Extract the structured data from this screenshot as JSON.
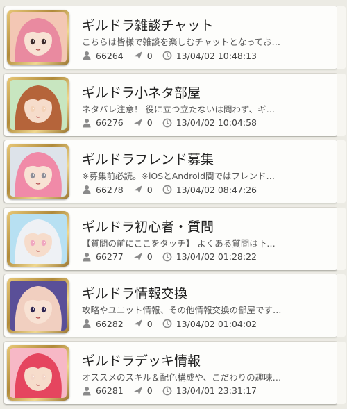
{
  "colors": {
    "background": "#ecebe4",
    "card": "#fdfdfb",
    "title_text": "#222222",
    "desc_text": "#555555",
    "meta_icon": "#8a8a8a",
    "thumb_frame": "#c9a34e"
  },
  "icons": {
    "member": "person-icon",
    "posts": "send-arrow-icon",
    "updated": "clock-icon"
  },
  "rooms": [
    {
      "title": "ギルドラ雑談チャット",
      "description": "こちらは皆様で雑談を楽しむチャットとなってお…",
      "members": "66264",
      "posts": "0",
      "timestamp": "13/04/02 10:48:13",
      "thumb_colors": [
        "#f3c7b4",
        "#e98aa0",
        "#3b2a2a"
      ]
    },
    {
      "title": "ギルドラ小ネタ部屋",
      "description": "ネタバレ注意！ 役に立つ立たないは問わず、ギ…",
      "members": "66276",
      "posts": "0",
      "timestamp": "13/04/02 10:04:58",
      "thumb_colors": [
        "#c8e6c0",
        "#b5643a",
        "#f3d2b8"
      ]
    },
    {
      "title": "ギルドラフレンド募集",
      "description": "※募集前必読。※iOSとAndroid間ではフレンド…",
      "members": "66278",
      "posts": "0",
      "timestamp": "13/04/02 08:47:26",
      "thumb_colors": [
        "#dde3ea",
        "#f08aa8",
        "#8d8f98"
      ]
    },
    {
      "title": "ギルドラ初心者・質問",
      "description": "【質問の前にここをタッチ】 よくある質問は下…",
      "members": "66277",
      "posts": "0",
      "timestamp": "13/04/02 01:28:22",
      "thumb_colors": [
        "#b7e0f2",
        "#eef1f5",
        "#f0a7c0"
      ]
    },
    {
      "title": "ギルドラ情報交換",
      "description": "攻略やユニット情報、その他情報交換の部屋です…",
      "members": "66282",
      "posts": "0",
      "timestamp": "13/04/02 01:04:02",
      "thumb_colors": [
        "#5a4f98",
        "#f1cfc0",
        "#2e2450"
      ]
    },
    {
      "title": "ギルドラデッキ情報",
      "description": "オススメのスキル＆配色構成や、こだわりの趣味…",
      "members": "66281",
      "posts": "0",
      "timestamp": "13/04/01 23:31:17",
      "thumb_colors": [
        "#f7b8c6",
        "#e5455f",
        "#f3d6c8"
      ]
    }
  ]
}
